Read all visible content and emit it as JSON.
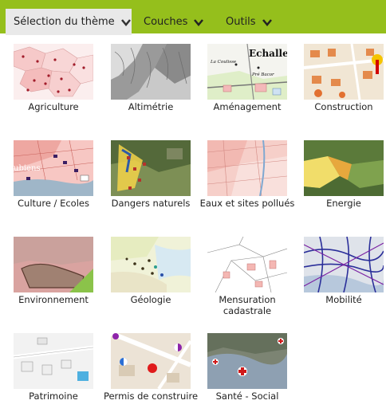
{
  "menu": {
    "theme_label": "Sélection du thème",
    "layers_label": "Couches",
    "tools_label": "Outils"
  },
  "themes": [
    {
      "label": "Agriculture"
    },
    {
      "label": "Altimétrie"
    },
    {
      "label": "Aménagement"
    },
    {
      "label": "Construction"
    },
    {
      "label": "Culture / Ecoles"
    },
    {
      "label": "Dangers naturels"
    },
    {
      "label": "Eaux et sites pollués"
    },
    {
      "label": "Energie"
    },
    {
      "label": "Environnement"
    },
    {
      "label": "Géologie"
    },
    {
      "label": "Mensuration cadastrale"
    },
    {
      "label": "Mobilité"
    },
    {
      "label": "Patrimoine"
    },
    {
      "label": "Permis de construire"
    },
    {
      "label": "Santé - Social"
    }
  ],
  "map_text": {
    "amenagement_place": "Echalle",
    "amenagement_sub1": "La Coulisse",
    "amenagement_sub2": "Pré Bacor",
    "culture_place": "ubiens"
  },
  "colors": {
    "topbar": "#95bf1c",
    "active_tab": "#e9e9e9"
  }
}
